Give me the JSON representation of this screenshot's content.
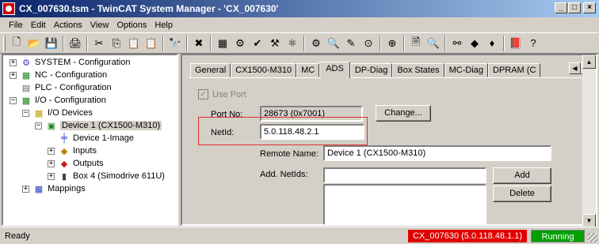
{
  "window": {
    "title": "CX_007630.tsm - TwinCAT System Manager - 'CX_007630'",
    "min": "_",
    "max": "□",
    "close": "×"
  },
  "menu": [
    {
      "label": "File",
      "key": "F"
    },
    {
      "label": "Edit",
      "key": "E"
    },
    {
      "label": "Actions",
      "key": "A"
    },
    {
      "label": "View",
      "key": "V"
    },
    {
      "label": "Options",
      "key": "O"
    },
    {
      "label": "Help",
      "key": "H"
    }
  ],
  "toolbar": {
    "icons": [
      "new-icon",
      "open-icon",
      "save-icon",
      "sep",
      "print-icon",
      "sep",
      "cut-icon",
      "copy-icon",
      "paste-icon",
      "paste-special-icon",
      "sep",
      "find-icon",
      "sep",
      "delete-icon",
      "sep",
      "activate-icon",
      "generate-mappings-icon",
      "check-icon",
      "build-icon",
      "config-mode-icon",
      "sep",
      "run-mode-icon",
      "scan-icon",
      "wand-icon",
      "target-icon",
      "sep",
      "add-icon",
      "sep",
      "preview-icon",
      "find-doc-icon",
      "sep",
      "glasses-icon",
      "online-icon",
      "io-icon",
      "sep",
      "book-icon",
      "help-icon"
    ],
    "glyphs": {
      "new-icon": "🗋",
      "open-icon": "📂",
      "save-icon": "💾",
      "print-icon": "🖨",
      "cut-icon": "✂",
      "copy-icon": "⎘",
      "paste-icon": "📋",
      "paste-special-icon": "📋",
      "find-icon": "🔭",
      "delete-icon": "✖",
      "activate-icon": "▦",
      "generate-mappings-icon": "⚙",
      "check-icon": "✔",
      "build-icon": "⚒",
      "config-mode-icon": "⚛",
      "run-mode-icon": "⚙",
      "scan-icon": "🔍",
      "wand-icon": "✎",
      "target-icon": "⊙",
      "add-icon": "⊕",
      "preview-icon": "🗎",
      "find-doc-icon": "🔍",
      "glasses-icon": "⚯",
      "online-icon": "◆",
      "io-icon": "♦",
      "book-icon": "📕",
      "help-icon": "?"
    }
  },
  "tree": {
    "items": [
      {
        "label": "SYSTEM - Configuration",
        "icon": "system-config-icon",
        "glyph": "⚙",
        "color": "#4040c0",
        "exp": "+"
      },
      {
        "label": "NC - Configuration",
        "icon": "nc-config-icon",
        "glyph": "▦",
        "color": "#208020",
        "exp": "+"
      },
      {
        "label": "PLC - Configuration",
        "icon": "plc-config-icon",
        "glyph": "▤",
        "color": "#606060",
        "exp": ""
      },
      {
        "label": "I/O - Configuration",
        "icon": "io-config-icon",
        "glyph": "▩",
        "color": "#208020",
        "exp": "−"
      },
      {
        "label": "I/O Devices",
        "icon": "io-devices-icon",
        "glyph": "▦",
        "color": "#c0a000",
        "exp": "−"
      },
      {
        "label": "Device 1 (CX1500-M310)",
        "icon": "device-icon",
        "glyph": "▣",
        "color": "#208020",
        "exp": "−"
      },
      {
        "label": "Device 1-Image",
        "icon": "image-icon",
        "glyph": "╪",
        "color": "#2040c0",
        "exp": ""
      },
      {
        "label": "Inputs",
        "icon": "inputs-icon",
        "glyph": "◆",
        "color": "#c08000",
        "exp": "+"
      },
      {
        "label": "Outputs",
        "icon": "outputs-icon",
        "glyph": "◆",
        "color": "#c02020",
        "exp": "+"
      },
      {
        "label": "Box 4 (Simodrive 611U)",
        "icon": "box-icon",
        "glyph": "▮",
        "color": "#404040",
        "exp": "+"
      },
      {
        "label": "Mappings",
        "icon": "mappings-icon",
        "glyph": "▦",
        "color": "#2040c0",
        "exp": "+"
      }
    ]
  },
  "tabs": [
    {
      "label": "General",
      "active": false
    },
    {
      "label": "CX1500-M310",
      "active": false
    },
    {
      "label": "MC",
      "active": false
    },
    {
      "label": "ADS",
      "active": true
    },
    {
      "label": "DP-Diag",
      "active": false
    },
    {
      "label": "Box States",
      "active": false
    },
    {
      "label": "MC-Diag",
      "active": false
    },
    {
      "label": "DPRAM (C",
      "active": false
    }
  ],
  "tab_scroll": {
    "left": "◀",
    "right": "▶"
  },
  "ads": {
    "use_port_label": "Use Port",
    "use_port_check": "✓",
    "port_no_label": "Port No:",
    "port_no_value": "28673 (0x7001)",
    "change_button": "Change...",
    "netid_label": "NetId:",
    "netid_value": "5.0.118.48.2.1",
    "remote_name_label": "Remote Name:",
    "remote_name_value": "Device 1 (CX1500-M310)",
    "add_netids_label": "Add. NetIds:",
    "add_netids_value": "",
    "add_button": "Add",
    "delete_button": "Delete"
  },
  "scroll": {
    "up": "▲",
    "down": "▼"
  },
  "status": {
    "text": "Ready",
    "target": "CX_007630 (5.0.118.48.1.1)",
    "state": "Running",
    "target_color": "#e00000",
    "state_color": "#00a000"
  }
}
